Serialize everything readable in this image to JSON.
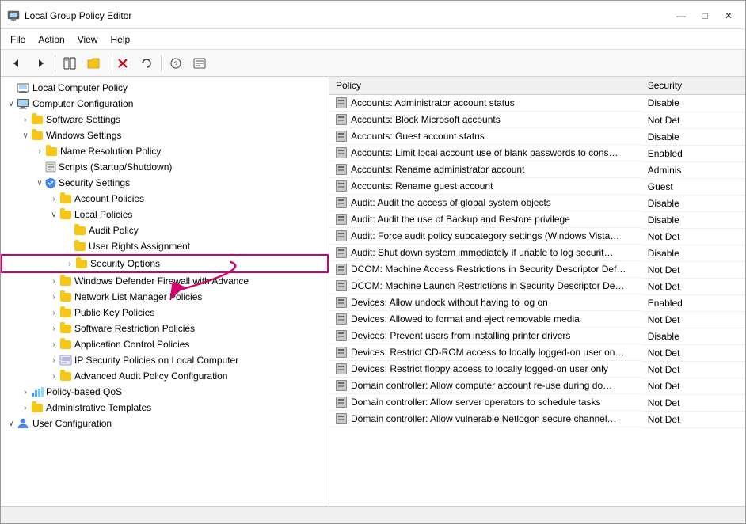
{
  "titleBar": {
    "icon": "📋",
    "title": "Local Group Policy Editor",
    "controls": [
      "—",
      "□",
      "✕"
    ]
  },
  "menuBar": {
    "items": [
      "File",
      "Action",
      "View",
      "Help"
    ]
  },
  "toolbar": {
    "buttons": [
      "◀",
      "▶",
      "📁",
      "📄",
      "✕",
      "↩",
      "❓",
      "🗒"
    ]
  },
  "tree": {
    "root": "Local Computer Policy",
    "items": [
      {
        "id": "computer-config",
        "label": "Computer Configuration",
        "level": 1,
        "expanded": true,
        "type": "computer"
      },
      {
        "id": "software-settings",
        "label": "Software Settings",
        "level": 2,
        "expanded": false,
        "type": "folder"
      },
      {
        "id": "windows-settings",
        "label": "Windows Settings",
        "level": 2,
        "expanded": true,
        "type": "folder"
      },
      {
        "id": "name-resolution",
        "label": "Name Resolution Policy",
        "level": 3,
        "expanded": false,
        "type": "folder"
      },
      {
        "id": "scripts",
        "label": "Scripts (Startup/Shutdown)",
        "level": 3,
        "expanded": false,
        "type": "policy"
      },
      {
        "id": "security-settings",
        "label": "Security Settings",
        "level": 3,
        "expanded": true,
        "type": "shield"
      },
      {
        "id": "account-policies",
        "label": "Account Policies",
        "level": 4,
        "expanded": false,
        "type": "folder"
      },
      {
        "id": "local-policies",
        "label": "Local Policies",
        "level": 4,
        "expanded": true,
        "type": "folder"
      },
      {
        "id": "audit-policy",
        "label": "Audit Policy",
        "level": 5,
        "expanded": false,
        "type": "folder"
      },
      {
        "id": "user-rights",
        "label": "User Rights Assignment",
        "level": 5,
        "expanded": false,
        "type": "folder"
      },
      {
        "id": "security-options",
        "label": "Security Options",
        "level": 5,
        "expanded": false,
        "type": "folder",
        "highlighted": true
      },
      {
        "id": "windows-defender",
        "label": "Windows Defender Firewall with Advance",
        "level": 4,
        "expanded": false,
        "type": "folder"
      },
      {
        "id": "network-list",
        "label": "Network List Manager Policies",
        "level": 4,
        "expanded": false,
        "type": "folder"
      },
      {
        "id": "public-key",
        "label": "Public Key Policies",
        "level": 4,
        "expanded": false,
        "type": "folder"
      },
      {
        "id": "software-restriction",
        "label": "Software Restriction Policies",
        "level": 4,
        "expanded": false,
        "type": "folder"
      },
      {
        "id": "application-control",
        "label": "Application Control Policies",
        "level": 4,
        "expanded": false,
        "type": "folder"
      },
      {
        "id": "ip-security",
        "label": "IP Security Policies on Local Computer",
        "level": 4,
        "expanded": false,
        "type": "policy"
      },
      {
        "id": "advanced-audit",
        "label": "Advanced Audit Policy Configuration",
        "level": 4,
        "expanded": false,
        "type": "folder"
      },
      {
        "id": "policy-qos",
        "label": "Policy-based QoS",
        "level": 2,
        "expanded": false,
        "type": "bar"
      },
      {
        "id": "admin-templates",
        "label": "Administrative Templates",
        "level": 2,
        "expanded": false,
        "type": "folder"
      },
      {
        "id": "user-config",
        "label": "User Configuration",
        "level": 1,
        "expanded": true,
        "type": "user"
      }
    ]
  },
  "policyTable": {
    "headers": [
      "Policy",
      "Security"
    ],
    "rows": [
      {
        "name": "Accounts: Administrator account status",
        "security": "Disable"
      },
      {
        "name": "Accounts: Block Microsoft accounts",
        "security": "Not Det"
      },
      {
        "name": "Accounts: Guest account status",
        "security": "Disable"
      },
      {
        "name": "Accounts: Limit local account use of blank passwords to cons…",
        "security": "Enabled"
      },
      {
        "name": "Accounts: Rename administrator account",
        "security": "Adminis"
      },
      {
        "name": "Accounts: Rename guest account",
        "security": "Guest"
      },
      {
        "name": "Audit: Audit the access of global system objects",
        "security": "Disable"
      },
      {
        "name": "Audit: Audit the use of Backup and Restore privilege",
        "security": "Disable"
      },
      {
        "name": "Audit: Force audit policy subcategory settings (Windows Vista…",
        "security": "Not Det"
      },
      {
        "name": "Audit: Shut down system immediately if unable to log securit…",
        "security": "Disable"
      },
      {
        "name": "DCOM: Machine Access Restrictions in Security Descriptor Def…",
        "security": "Not Det"
      },
      {
        "name": "DCOM: Machine Launch Restrictions in Security Descriptor De…",
        "security": "Not Det"
      },
      {
        "name": "Devices: Allow undock without having to log on",
        "security": "Enabled"
      },
      {
        "name": "Devices: Allowed to format and eject removable media",
        "security": "Not Det"
      },
      {
        "name": "Devices: Prevent users from installing printer drivers",
        "security": "Disable"
      },
      {
        "name": "Devices: Restrict CD-ROM access to locally logged-on user on…",
        "security": "Not Det"
      },
      {
        "name": "Devices: Restrict floppy access to locally logged-on user only",
        "security": "Not Det"
      },
      {
        "name": "Domain controller: Allow computer account re-use during do…",
        "security": "Not Det"
      },
      {
        "name": "Domain controller: Allow server operators to schedule tasks",
        "security": "Not Det"
      },
      {
        "name": "Domain controller: Allow vulnerable Netlogon secure channel…",
        "security": "Not Det"
      }
    ]
  },
  "statusBar": {
    "text": ""
  }
}
